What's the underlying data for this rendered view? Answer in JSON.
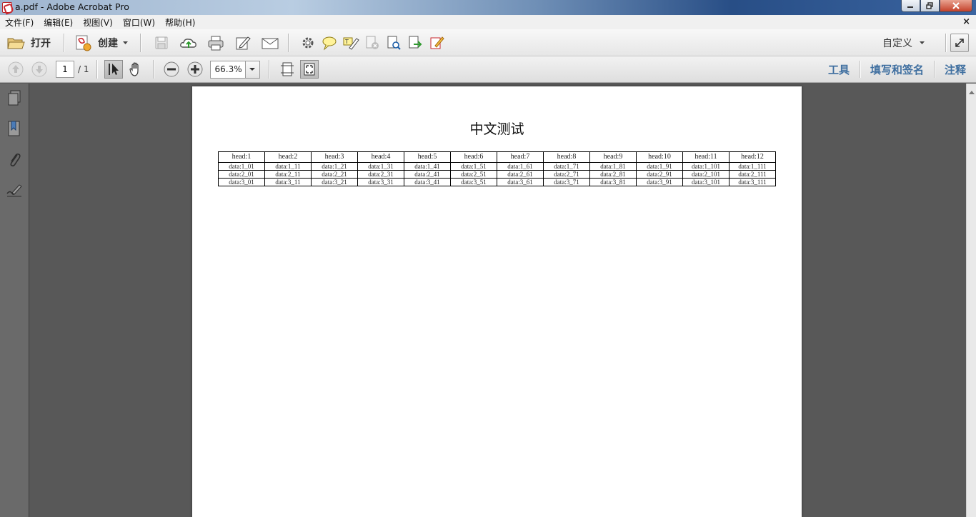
{
  "window": {
    "title": "a.pdf - Adobe Acrobat Pro"
  },
  "menu": {
    "items": [
      "文件(F)",
      "编辑(E)",
      "视图(V)",
      "窗口(W)",
      "帮助(H)"
    ],
    "close": "×"
  },
  "toolbar": {
    "open_label": "打开",
    "create_label": "创建",
    "customize_label": "自定义",
    "page_number": "1",
    "page_total": "/ 1",
    "zoom": "66.3%",
    "tools_label": "工具",
    "fill_sign_label": "填写和签名",
    "comment_label": "注释"
  },
  "document": {
    "title": "中文测试",
    "table": {
      "headers": [
        "head:1",
        "head:2",
        "head:3",
        "head:4",
        "head:5",
        "head:6",
        "head:7",
        "head:8",
        "head:9",
        "head:10",
        "head:11",
        "head:12"
      ],
      "rows": [
        [
          "data:1_01",
          "data:1_11",
          "data:1_21",
          "data:1_31",
          "data:1_41",
          "data:1_51",
          "data:1_61",
          "data:1_71",
          "data:1_81",
          "data:1_91",
          "data:1_101",
          "data:1_111"
        ],
        [
          "data:2_01",
          "data:2_11",
          "data:2_21",
          "data:2_31",
          "data:2_41",
          "data:2_51",
          "data:2_61",
          "data:2_71",
          "data:2_81",
          "data:2_91",
          "data:2_101",
          "data:2_111"
        ],
        [
          "data:3_01",
          "data:3_11",
          "data:3_21",
          "data:3_31",
          "data:3_41",
          "data:3_51",
          "data:3_61",
          "data:3_71",
          "data:3_81",
          "data:3_91",
          "data:3_101",
          "data:3_111"
        ]
      ]
    }
  }
}
